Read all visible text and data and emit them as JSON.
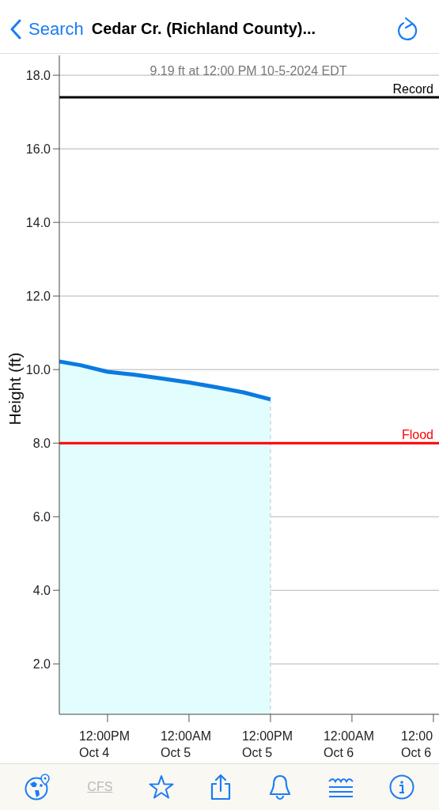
{
  "nav_bar": {
    "back_label": "Search",
    "title": "Cedar Cr. (Richland County)..."
  },
  "chart": {
    "reading": "9.19 ft at 12:00 PM 10-5-2024 EDT",
    "chart_data": {
      "type": "area",
      "ylabel": "Height (ft)",
      "categories": [
        null,
        null,
        "12:00PM\nOct 4",
        null,
        null,
        "12:00AM\nOct 5",
        null,
        null,
        "12:00PM\nOct 5",
        null,
        null,
        "12:00AM\nOct 6",
        null,
        null,
        "12:00\nOct 6"
      ],
      "grid": true,
      "series": [
        {
          "color": "#0a7be0",
          "values": [
            10.25,
            10.12,
            9.94,
            9.86,
            9.76,
            9.65,
            9.52,
            9.38,
            9.19,
            null,
            null,
            null,
            null,
            null,
            null
          ]
        }
      ],
      "ylim": [
        0.63,
        18.54
      ],
      "yticks": [
        {
          "value": 2,
          "label": "2.0"
        },
        {
          "value": 4,
          "label": "4.0"
        },
        {
          "value": 6,
          "label": "6.0"
        },
        {
          "value": 8,
          "label": "8.0"
        },
        {
          "value": 10,
          "label": "10.0"
        },
        {
          "value": 12,
          "label": "12.0"
        },
        {
          "value": 14,
          "label": "14.0"
        },
        {
          "value": 16,
          "label": "16.0"
        },
        {
          "value": 18,
          "label": "18.0"
        }
      ],
      "ref_lines": [
        {
          "axis": "y",
          "value": 17.4,
          "label": "Record",
          "color": "#000000"
        },
        {
          "axis": "y",
          "value": 8.0,
          "label": "Flood",
          "color": "#ff0000"
        }
      ]
    }
  },
  "toolbar": {
    "units_label": "CFS",
    "units_disabled": true
  }
}
